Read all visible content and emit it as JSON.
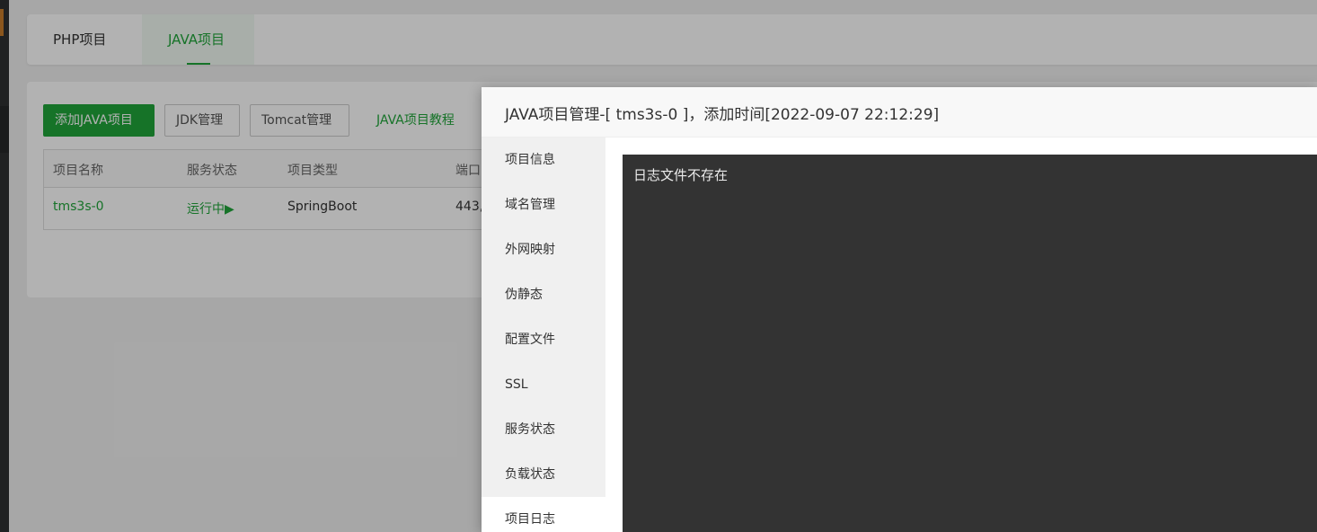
{
  "tabs": [
    {
      "label": "PHP项目"
    },
    {
      "label": "JAVA项目"
    }
  ],
  "toolbar": {
    "add_label": "添加JAVA项目",
    "jdk_label": "JDK管理",
    "tomcat_label": "Tomcat管理",
    "tutorial_label": "JAVA项目教程"
  },
  "table": {
    "headers": [
      "项目名称",
      "服务状态",
      "项目类型",
      "端口"
    ],
    "rows": [
      {
        "name": "tms3s-0",
        "status": "运行中▶",
        "type": "SpringBoot",
        "port": "443,"
      }
    ]
  },
  "modal": {
    "title": "JAVA项目管理-[ tms3s-0 ]，添加时间[2022-09-07 22:12:29]",
    "nav": [
      "项目信息",
      "域名管理",
      "外网映射",
      "伪静态",
      "配置文件",
      "SSL",
      "服务状态",
      "负载状态",
      "项目日志"
    ],
    "active_nav": "项目日志",
    "log_text": "日志文件不存在"
  },
  "colors": {
    "accent": "#20a53a",
    "log_bg": "#333333"
  }
}
